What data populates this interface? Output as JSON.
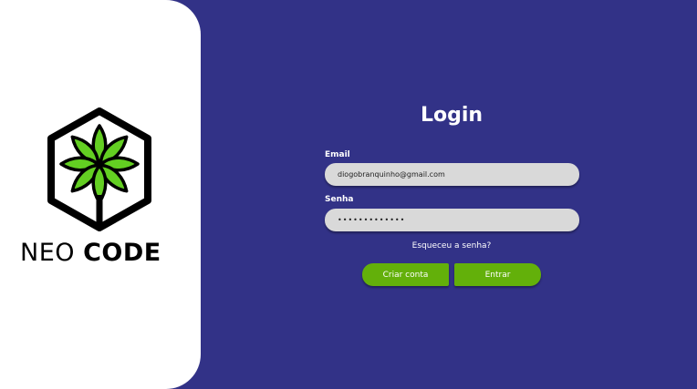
{
  "brand": {
    "word1": "NEO",
    "word2": "CODE"
  },
  "colors": {
    "background": "#323287",
    "panel": "#ffffff",
    "leaf": "#63cf22",
    "button": "#63b00a",
    "input": "#d9d9d9"
  },
  "login": {
    "title": "Login",
    "email_label": "Email",
    "email_value": "diogobranquinho@gmail.com",
    "password_label": "Senha",
    "password_value": "•••••••••••••",
    "forgot_link": "Esqueceu a senha?",
    "create_button": "Criar conta",
    "enter_button": "Entrar"
  }
}
